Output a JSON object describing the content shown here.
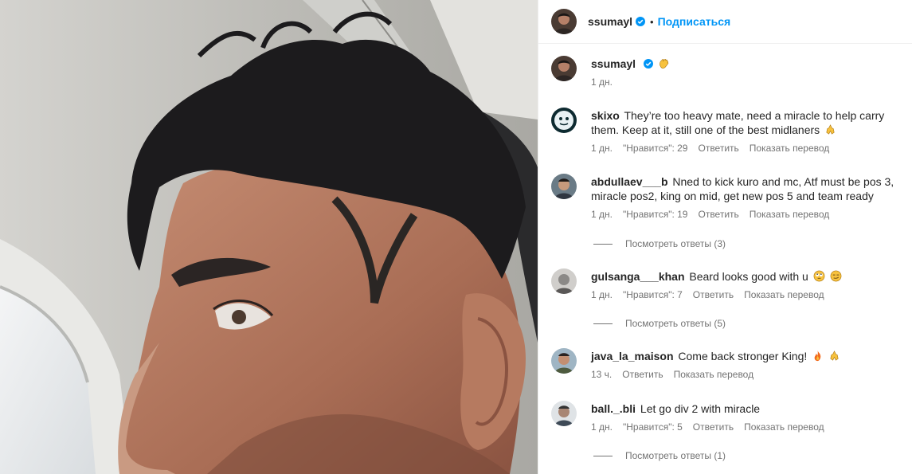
{
  "post": {
    "username": "ssumayl",
    "follow_label": "Подписаться",
    "separator": "•",
    "caption_time": "1 дн."
  },
  "colors": {
    "link": "#0095f6",
    "verified": "#0095f6",
    "muted": "#737373"
  },
  "comments": [
    {
      "username": "skixo",
      "text": "They’re too heavy mate, need a miracle to help carry them. Keep at it, still one of the best midlaners",
      "emoji": [
        "pray-hands-icon"
      ],
      "time": "1 дн.",
      "likes": "\"Нравится\": 29",
      "reply": "Ответить",
      "translate": "Показать перевод"
    },
    {
      "username": "abdullaev___b",
      "text": "Nned to kick kuro and mc, Atf must be pos 3, miracle pos2, king on mid, get new pos 5 and team ready",
      "time": "1 дн.",
      "likes": "\"Нравится\": 19",
      "reply": "Ответить",
      "translate": "Показать перевод",
      "view_replies": "Посмотреть ответы (3)"
    },
    {
      "username": "gulsanga___khan",
      "text": "Beard looks good with u",
      "emoji": [
        "rolling-eyes-icon",
        "smirk-icon"
      ],
      "time": "1 дн.",
      "likes": "\"Нравится\": 7",
      "reply": "Ответить",
      "translate": "Показать перевод",
      "view_replies": "Посмотреть ответы (5)"
    },
    {
      "username": "java_la_maison",
      "text": "Come back stronger King!",
      "emoji": [
        "fire-icon",
        "pray-hands-icon"
      ],
      "time": "13 ч.",
      "reply": "Ответить",
      "translate": "Показать перевод"
    },
    {
      "username": "ball._.bli",
      "text": "Let go div 2 with miracle",
      "time": "1 дн.",
      "likes": "\"Нравится\": 5",
      "reply": "Ответить",
      "translate": "Показать перевод",
      "view_replies": "Посмотреть ответы (1)"
    }
  ]
}
